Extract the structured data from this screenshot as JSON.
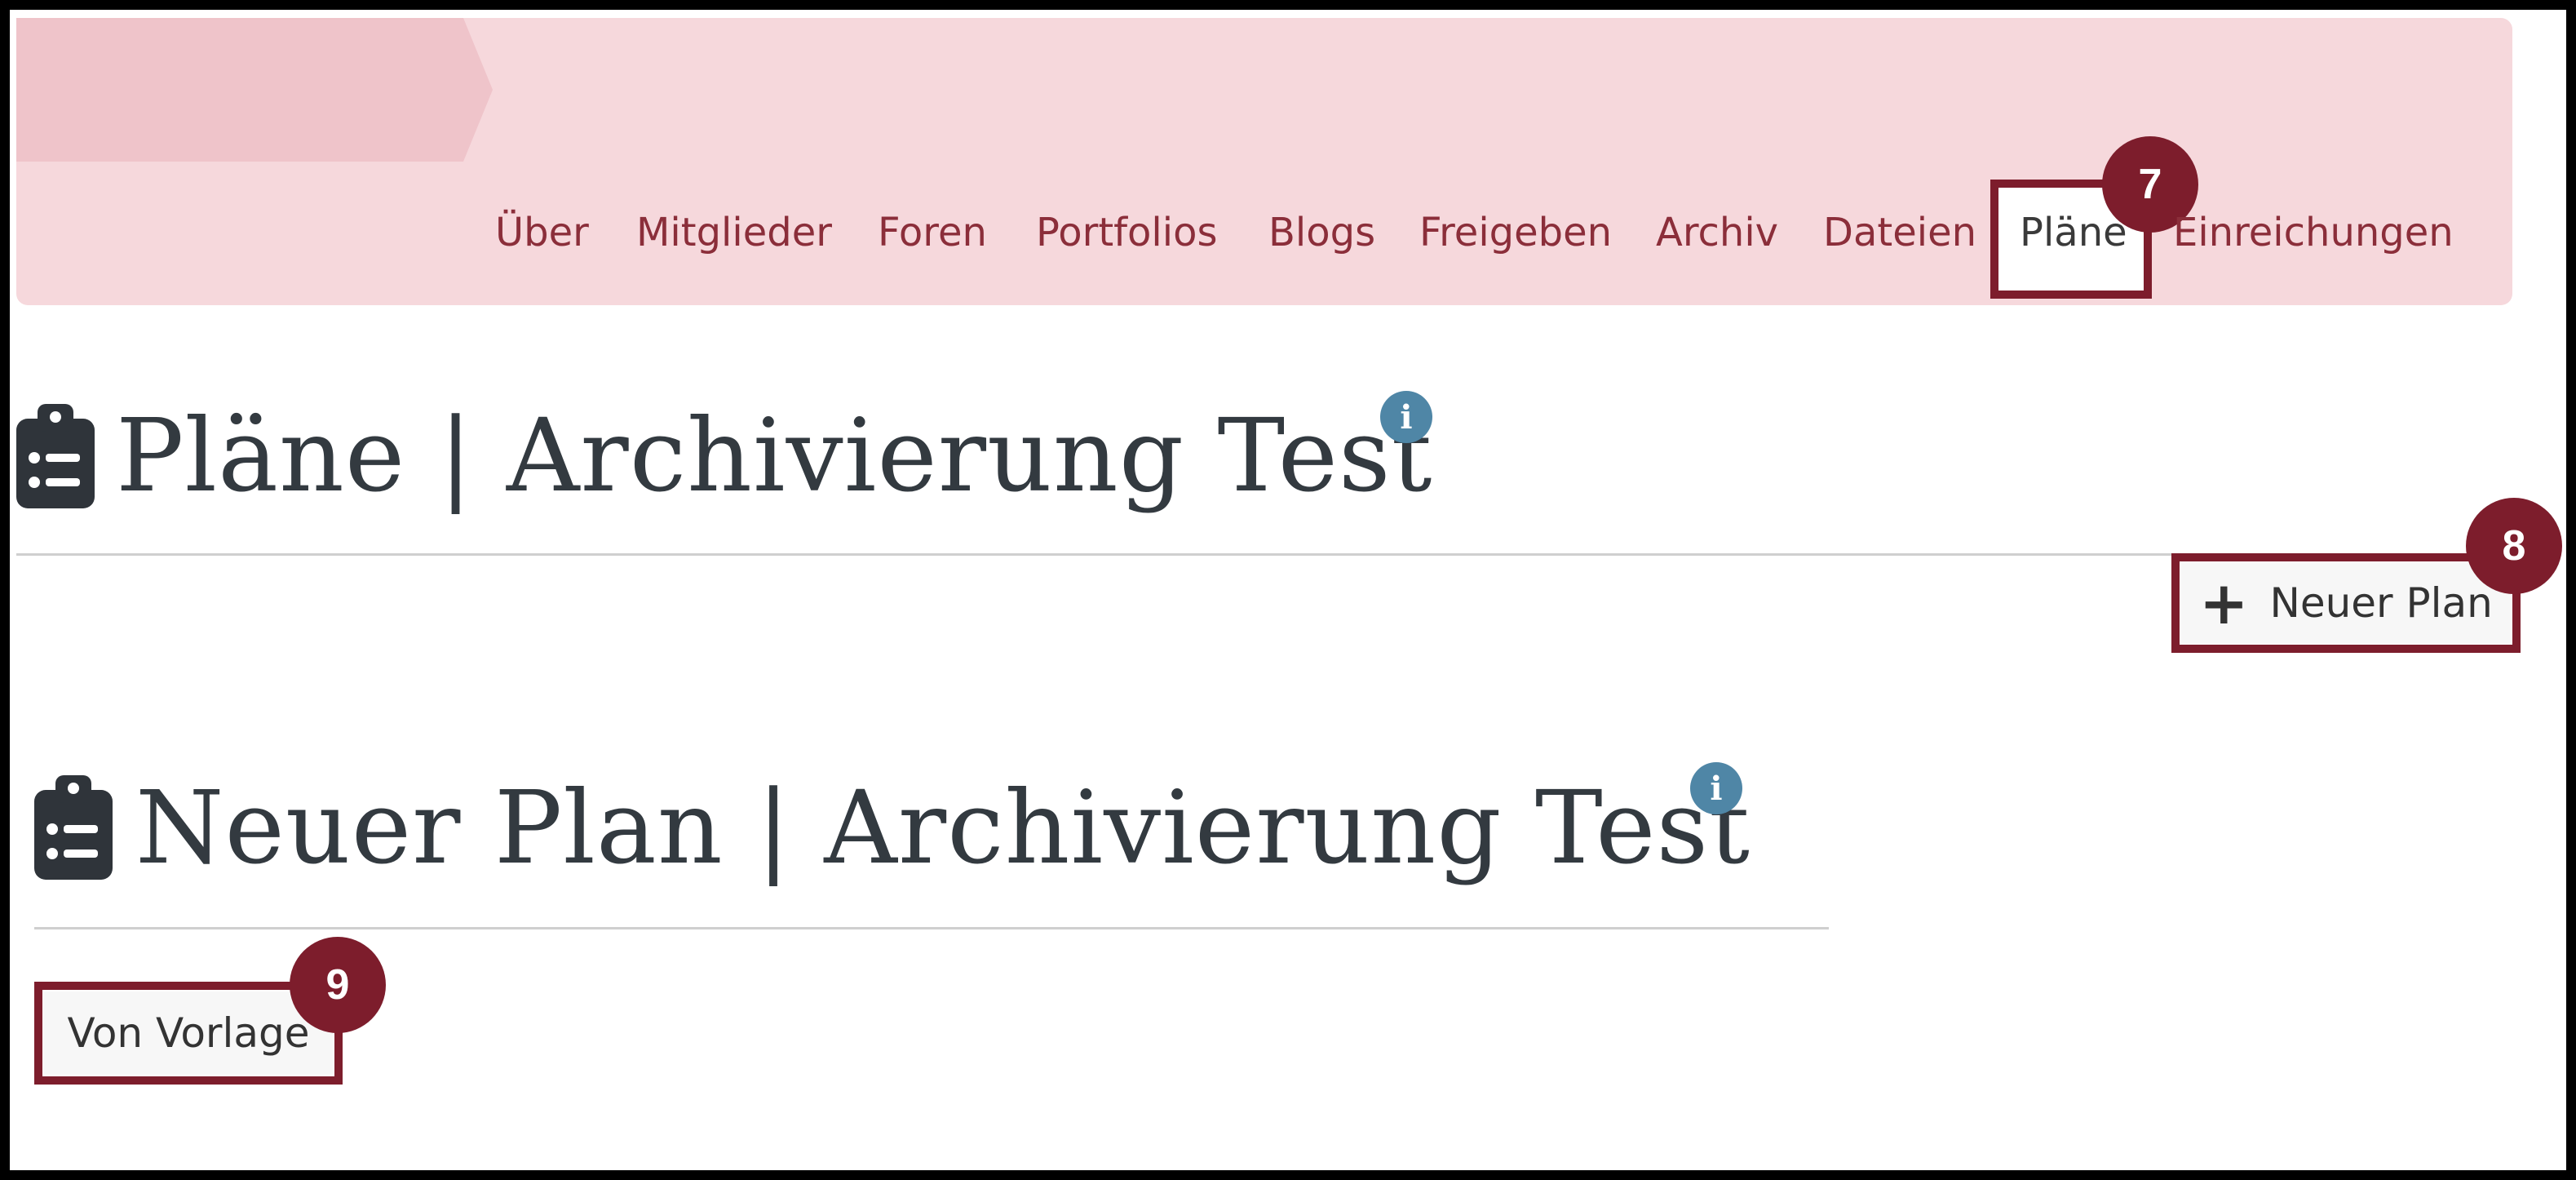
{
  "nav": {
    "items": [
      {
        "label": "Über"
      },
      {
        "label": "Mitglieder"
      },
      {
        "label": "Foren"
      },
      {
        "label": "Portfolios"
      },
      {
        "label": "Blogs"
      },
      {
        "label": "Freigeben"
      },
      {
        "label": "Archiv"
      },
      {
        "label": "Dateien"
      },
      {
        "label": "Pläne"
      },
      {
        "label": "Einreichungen"
      }
    ],
    "active": "Pläne"
  },
  "annotations": {
    "step7": "7",
    "step8": "8",
    "step9": "9"
  },
  "plans": {
    "title": "Pläne | Archivierung Test",
    "new_plan_button": "Neuer Plan",
    "new_plan_icon": "plus-icon"
  },
  "new_plan": {
    "title": "Neuer Plan | Archivierung Test",
    "from_template_button": "Von Vorlage"
  },
  "icons": {
    "clipboard": "clipboard-list-icon",
    "info": "info-icon"
  },
  "colors": {
    "header_bg": "#f6d8dc",
    "nav_text": "#8b2e3a",
    "highlight": "#7d1d2c",
    "info": "#4f86a6",
    "heading": "#333a40"
  }
}
